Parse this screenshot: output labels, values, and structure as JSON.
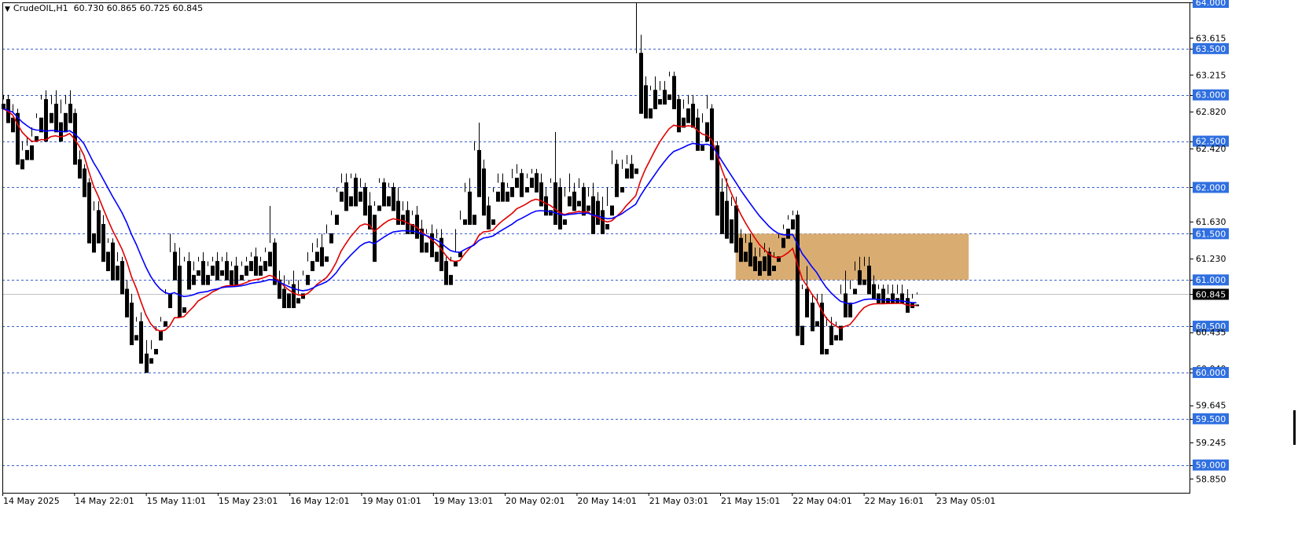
{
  "header": {
    "symbol": "CrudeOIL,H1",
    "ohlc": "60.730 60.865 60.725 60.845",
    "menu_icon": "triangle-down-icon"
  },
  "colors": {
    "background": "#ffffff",
    "candle_up_body": "#ffffff",
    "candle_down_body": "#000000",
    "candle_outline": "#000000",
    "ma_fast": "#e00000",
    "ma_slow": "#0000ff",
    "level_line": "#3a5fcd",
    "level_label_bg": "#2f6fe0",
    "zone_fill": "#d9ad72",
    "current_price_line": "#c0c0c0"
  },
  "chart_data": {
    "type": "candlestick",
    "symbol": "CrudeOIL",
    "timeframe": "H1",
    "ylim": [
      58.7,
      64.0
    ],
    "price_scale_labels": [
      "64.000",
      "63.615",
      "63.500",
      "63.215",
      "63.000",
      "62.820",
      "62.500",
      "62.420",
      "62.000",
      "61.630",
      "61.500",
      "61.230",
      "61.000",
      "60.845",
      "60.500",
      "60.435",
      "60.040",
      "60.000",
      "59.645",
      "59.500",
      "59.245",
      "59.000",
      "58.850"
    ],
    "horizontal_levels": [
      "64.000",
      "63.500",
      "63.000",
      "62.500",
      "62.000",
      "61.500",
      "61.000",
      "60.500",
      "60.000",
      "59.500",
      "59.000"
    ],
    "current_price": "60.845",
    "x_labels": [
      "14 May 2025",
      "14 May 22:01",
      "15 May 11:01",
      "15 May 23:01",
      "16 May 12:01",
      "19 May 01:01",
      "19 May 13:01",
      "20 May 02:01",
      "20 May 14:01",
      "21 May 03:01",
      "21 May 15:01",
      "22 May 04:01",
      "22 May 16:01",
      "23 May 05:01"
    ],
    "zone": {
      "price_low": 61.0,
      "price_high": 61.5,
      "start_bar": 154,
      "end_bar": 203
    },
    "series": [
      {
        "name": "MA fast",
        "color": "#e00000"
      },
      {
        "name": "MA slow",
        "color": "#0000ff"
      }
    ],
    "candles": [
      [
        62.9,
        63.0,
        62.95,
        62.85
      ],
      [
        62.95,
        63.0,
        62.75,
        62.7
      ],
      [
        62.75,
        62.9,
        62.8,
        62.6
      ],
      [
        62.8,
        62.85,
        62.3,
        62.25
      ],
      [
        62.3,
        62.5,
        62.4,
        62.2
      ],
      [
        62.4,
        62.55,
        62.45,
        62.3
      ],
      [
        62.45,
        62.65,
        62.55,
        62.3
      ],
      [
        62.55,
        62.8,
        62.75,
        62.5
      ],
      [
        62.75,
        63.0,
        62.95,
        62.6
      ],
      [
        62.95,
        63.05,
        62.8,
        62.5
      ],
      [
        62.8,
        63.0,
        62.9,
        62.7
      ],
      [
        62.9,
        63.05,
        62.7,
        62.6
      ],
      [
        62.7,
        62.95,
        62.8,
        62.5
      ],
      [
        62.8,
        63.0,
        62.9,
        62.6
      ],
      [
        62.9,
        63.05,
        62.8,
        62.7
      ],
      [
        62.8,
        62.85,
        62.3,
        62.25
      ],
      [
        62.3,
        62.4,
        62.2,
        62.1
      ],
      [
        62.2,
        62.25,
        62.05,
        61.9
      ],
      [
        62.05,
        62.1,
        61.5,
        61.4
      ],
      [
        61.5,
        61.85,
        61.75,
        61.3
      ],
      [
        61.75,
        61.85,
        61.6,
        61.4
      ],
      [
        61.6,
        61.7,
        61.3,
        61.2
      ],
      [
        61.3,
        61.45,
        61.4,
        61.1
      ],
      [
        61.4,
        61.45,
        61.15,
        61.0
      ],
      [
        61.15,
        61.3,
        61.2,
        61.0
      ],
      [
        61.2,
        61.25,
        60.9,
        60.85
      ],
      [
        60.9,
        61.0,
        60.75,
        60.6
      ],
      [
        60.75,
        60.85,
        60.4,
        60.3
      ],
      [
        60.4,
        60.6,
        60.55,
        60.35
      ],
      [
        60.55,
        60.65,
        60.2,
        60.1
      ],
      [
        60.2,
        60.35,
        60.15,
        60.0
      ],
      [
        60.15,
        60.35,
        60.25,
        60.1
      ],
      [
        60.25,
        60.5,
        60.45,
        60.2
      ],
      [
        60.45,
        60.6,
        60.55,
        60.35
      ],
      [
        60.55,
        60.9,
        60.85,
        60.5
      ],
      [
        60.85,
        61.5,
        61.3,
        60.7
      ],
      [
        61.3,
        61.4,
        61.15,
        61.0
      ],
      [
        61.15,
        61.35,
        60.7,
        60.6
      ],
      [
        60.7,
        61.25,
        61.2,
        60.65
      ],
      [
        61.2,
        61.3,
        61.05,
        60.9
      ],
      [
        61.05,
        61.2,
        61.1,
        60.95
      ],
      [
        61.1,
        61.25,
        61.2,
        61.05
      ],
      [
        61.2,
        61.3,
        61.05,
        60.95
      ],
      [
        61.05,
        61.2,
        61.15,
        60.95
      ],
      [
        61.15,
        61.25,
        61.2,
        61.05
      ],
      [
        61.2,
        61.3,
        61.1,
        61.0
      ],
      [
        61.1,
        61.25,
        61.2,
        61.05
      ],
      [
        61.2,
        61.3,
        61.1,
        61.0
      ],
      [
        61.1,
        61.2,
        61.15,
        60.95
      ],
      [
        61.15,
        61.25,
        61.05,
        60.95
      ],
      [
        61.05,
        61.2,
        61.15,
        61.0
      ],
      [
        61.15,
        61.25,
        61.2,
        61.05
      ],
      [
        61.2,
        61.3,
        61.25,
        61.1
      ],
      [
        61.25,
        61.35,
        61.15,
        61.05
      ],
      [
        61.15,
        61.25,
        61.2,
        61.05
      ],
      [
        61.2,
        61.35,
        61.3,
        61.1
      ],
      [
        61.3,
        61.8,
        61.4,
        61.15
      ],
      [
        61.4,
        61.45,
        61.0,
        60.95
      ],
      [
        61.0,
        61.1,
        60.9,
        60.8
      ],
      [
        60.9,
        61.05,
        60.85,
        60.7
      ],
      [
        60.85,
        61.0,
        60.95,
        60.7
      ],
      [
        60.95,
        61.1,
        60.8,
        60.7
      ],
      [
        60.8,
        61.0,
        60.85,
        60.75
      ],
      [
        60.85,
        61.1,
        61.05,
        60.8
      ],
      [
        61.05,
        61.3,
        61.2,
        60.95
      ],
      [
        61.2,
        61.4,
        61.3,
        61.1
      ],
      [
        61.3,
        61.45,
        61.35,
        61.2
      ],
      [
        61.35,
        61.5,
        61.25,
        61.15
      ],
      [
        61.25,
        61.6,
        61.5,
        61.2
      ],
      [
        61.5,
        61.75,
        61.7,
        61.4
      ],
      [
        61.7,
        62.0,
        61.95,
        61.6
      ],
      [
        61.95,
        62.15,
        62.05,
        61.85
      ],
      [
        62.05,
        62.15,
        61.9,
        61.75
      ],
      [
        61.9,
        62.15,
        62.1,
        61.8
      ],
      [
        62.1,
        62.15,
        61.95,
        61.8
      ],
      [
        61.95,
        62.1,
        62.0,
        61.85
      ],
      [
        62.0,
        62.05,
        61.8,
        61.7
      ],
      [
        61.8,
        61.95,
        61.7,
        61.55
      ],
      [
        61.7,
        61.85,
        61.8,
        61.2
      ],
      [
        61.8,
        62.1,
        62.05,
        61.75
      ],
      [
        62.05,
        62.1,
        61.9,
        61.8
      ],
      [
        61.9,
        62.05,
        62.0,
        61.8
      ],
      [
        62.0,
        62.05,
        61.85,
        61.75
      ],
      [
        61.85,
        62.0,
        61.7,
        61.6
      ],
      [
        61.7,
        61.85,
        61.75,
        61.6
      ],
      [
        61.75,
        61.85,
        61.6,
        61.5
      ],
      [
        61.6,
        61.75,
        61.7,
        61.5
      ],
      [
        61.7,
        61.8,
        61.55,
        61.45
      ],
      [
        61.55,
        61.65,
        61.4,
        61.3
      ],
      [
        61.4,
        61.55,
        61.5,
        61.3
      ],
      [
        61.5,
        61.6,
        61.3,
        61.25
      ],
      [
        61.3,
        61.55,
        61.45,
        61.2
      ],
      [
        61.45,
        61.55,
        61.2,
        61.1
      ],
      [
        61.2,
        61.25,
        61.05,
        60.95
      ],
      [
        61.05,
        61.25,
        61.2,
        60.95
      ],
      [
        61.2,
        61.55,
        61.3,
        61.15
      ],
      [
        61.3,
        61.75,
        61.65,
        61.25
      ],
      [
        61.65,
        62.05,
        61.95,
        61.6
      ],
      [
        61.95,
        62.1,
        61.7,
        61.6
      ],
      [
        61.7,
        62.5,
        62.4,
        61.6
      ],
      [
        62.4,
        62.7,
        62.2,
        61.9
      ],
      [
        62.2,
        62.3,
        61.8,
        61.7
      ],
      [
        61.8,
        61.9,
        61.65,
        61.55
      ],
      [
        61.65,
        62.0,
        61.95,
        61.6
      ],
      [
        61.95,
        62.15,
        62.05,
        61.85
      ],
      [
        62.05,
        62.15,
        61.95,
        61.85
      ],
      [
        61.95,
        62.05,
        62.0,
        61.85
      ],
      [
        62.0,
        62.2,
        62.1,
        61.9
      ],
      [
        62.1,
        62.25,
        62.15,
        62.0
      ],
      [
        62.15,
        62.2,
        62.0,
        61.9
      ],
      [
        62.0,
        62.15,
        62.1,
        61.95
      ],
      [
        62.1,
        62.2,
        62.15,
        62.0
      ],
      [
        62.15,
        62.2,
        62.05,
        61.95
      ],
      [
        62.05,
        62.15,
        61.9,
        61.8
      ],
      [
        61.9,
        62.0,
        61.75,
        61.7
      ],
      [
        61.75,
        62.1,
        62.05,
        61.7
      ],
      [
        62.05,
        62.6,
        62.0,
        61.6
      ],
      [
        62.0,
        62.1,
        61.65,
        61.55
      ],
      [
        61.65,
        62.0,
        61.9,
        61.6
      ],
      [
        61.9,
        62.15,
        61.95,
        61.8
      ],
      [
        61.95,
        62.05,
        61.85,
        61.75
      ],
      [
        61.85,
        62.1,
        62.0,
        61.8
      ],
      [
        62.0,
        62.05,
        61.8,
        61.7
      ],
      [
        61.8,
        62.0,
        61.9,
        61.75
      ],
      [
        61.9,
        62.05,
        61.85,
        61.5
      ],
      [
        61.85,
        61.95,
        61.75,
        61.6
      ],
      [
        61.75,
        61.9,
        61.6,
        61.5
      ],
      [
        61.6,
        62.0,
        61.8,
        61.55
      ],
      [
        61.8,
        62.4,
        62.25,
        61.7
      ],
      [
        62.25,
        62.3,
        62.0,
        61.9
      ],
      [
        62.0,
        62.3,
        62.2,
        61.95
      ],
      [
        62.2,
        62.35,
        62.25,
        62.1
      ],
      [
        62.25,
        62.35,
        62.2,
        62.1
      ],
      [
        62.2,
        64.0,
        63.45,
        62.15
      ],
      [
        63.45,
        63.65,
        63.1,
        62.8
      ],
      [
        63.1,
        63.2,
        62.85,
        62.75
      ],
      [
        62.85,
        63.1,
        63.05,
        62.75
      ],
      [
        63.05,
        63.2,
        62.95,
        62.85
      ],
      [
        62.95,
        63.15,
        63.05,
        62.9
      ],
      [
        63.05,
        63.15,
        63.0,
        62.9
      ],
      [
        63.0,
        63.25,
        63.2,
        62.95
      ],
      [
        63.2,
        63.25,
        62.95,
        62.85
      ],
      [
        62.95,
        63.0,
        62.75,
        62.6
      ],
      [
        62.75,
        62.95,
        62.85,
        62.65
      ],
      [
        62.85,
        63.0,
        62.9,
        62.7
      ],
      [
        62.9,
        63.0,
        62.75,
        62.65
      ],
      [
        62.75,
        62.85,
        62.45,
        62.4
      ],
      [
        62.45,
        62.8,
        62.7,
        62.4
      ],
      [
        62.7,
        63.0,
        62.85,
        62.5
      ],
      [
        62.85,
        62.9,
        62.45,
        62.3
      ],
      [
        62.45,
        62.5,
        61.95,
        61.7
      ],
      [
        61.95,
        62.1,
        61.85,
        61.5
      ],
      [
        61.85,
        62.1,
        61.65,
        61.45
      ],
      [
        61.65,
        61.9,
        61.8,
        61.4
      ],
      [
        61.8,
        61.9,
        61.45,
        61.3
      ],
      [
        61.45,
        61.55,
        61.3,
        61.2
      ],
      [
        61.3,
        61.5,
        61.4,
        61.2
      ],
      [
        61.4,
        61.5,
        61.25,
        61.15
      ],
      [
        61.25,
        61.35,
        61.2,
        61.1
      ],
      [
        61.2,
        61.35,
        61.25,
        61.05
      ],
      [
        61.25,
        61.4,
        61.3,
        61.1
      ],
      [
        61.3,
        61.35,
        61.15,
        61.05
      ],
      [
        61.15,
        61.3,
        61.25,
        61.1
      ],
      [
        61.25,
        61.5,
        61.45,
        61.2
      ],
      [
        61.45,
        61.6,
        61.55,
        61.35
      ],
      [
        61.55,
        61.7,
        61.65,
        61.45
      ],
      [
        61.65,
        61.75,
        61.7,
        61.55
      ],
      [
        61.7,
        61.75,
        60.5,
        60.4
      ],
      [
        60.5,
        60.95,
        60.9,
        60.3
      ],
      [
        60.9,
        61.15,
        60.75,
        60.6
      ],
      [
        60.75,
        60.85,
        60.55,
        60.45
      ],
      [
        60.55,
        60.85,
        60.75,
        60.5
      ],
      [
        60.75,
        60.85,
        60.25,
        60.2
      ],
      [
        60.25,
        60.6,
        60.5,
        60.2
      ],
      [
        60.5,
        60.6,
        60.4,
        60.3
      ],
      [
        60.4,
        60.55,
        60.5,
        60.35
      ],
      [
        60.5,
        60.95,
        60.85,
        60.35
      ],
      [
        60.85,
        61.1,
        60.75,
        60.6
      ],
      [
        60.75,
        61.0,
        60.9,
        60.6
      ],
      [
        60.9,
        61.2,
        61.1,
        60.85
      ],
      [
        61.1,
        61.25,
        61.0,
        60.95
      ],
      [
        61.0,
        61.25,
        61.15,
        60.95
      ],
      [
        61.15,
        61.25,
        60.95,
        60.85
      ],
      [
        60.95,
        61.05,
        60.85,
        60.8
      ],
      [
        60.85,
        60.95,
        60.9,
        60.75
      ],
      [
        60.9,
        60.95,
        60.8,
        60.75
      ],
      [
        60.8,
        60.95,
        60.85,
        60.75
      ],
      [
        60.85,
        60.95,
        60.8,
        60.75
      ],
      [
        60.8,
        60.95,
        60.85,
        60.75
      ],
      [
        60.85,
        60.95,
        60.8,
        60.75
      ],
      [
        60.8,
        60.9,
        60.75,
        60.65
      ],
      [
        60.75,
        60.85,
        60.8,
        60.7
      ],
      [
        60.73,
        60.865,
        60.845,
        60.725
      ]
    ]
  }
}
